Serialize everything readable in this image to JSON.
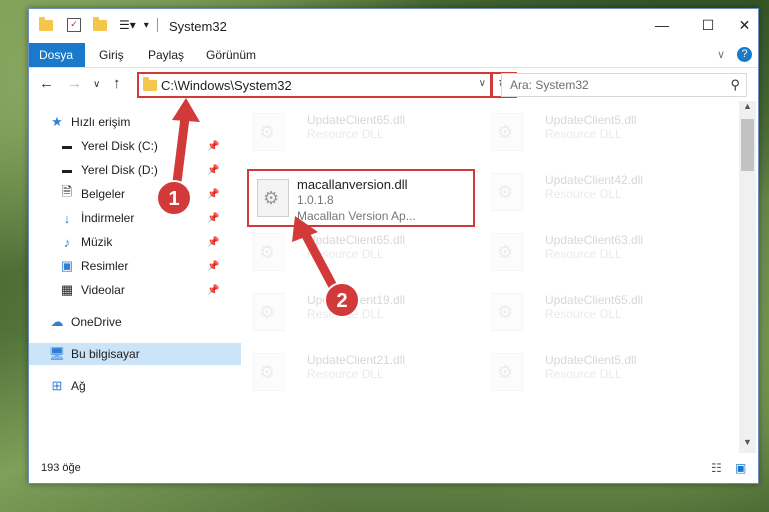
{
  "window": {
    "title": "System32",
    "ribbon_tabs": [
      "Dosya",
      "Giriş",
      "Paylaş",
      "Görünüm"
    ]
  },
  "address_bar": {
    "path": "C:\\Windows\\System32",
    "search_placeholder": "Ara: System32"
  },
  "sidebar": {
    "items": [
      {
        "label": "Hızlı erişim",
        "icon": "star-icon"
      },
      {
        "label": "Yerel Disk (C:)",
        "icon": "drive-icon"
      },
      {
        "label": "Yerel Disk (D:)",
        "icon": "drive-icon"
      },
      {
        "label": "Belgeler",
        "icon": "documents-icon"
      },
      {
        "label": "İndirmeler",
        "icon": "download-icon"
      },
      {
        "label": "Müzik",
        "icon": "music-icon"
      },
      {
        "label": "Resimler",
        "icon": "pictures-icon"
      },
      {
        "label": "Videolar",
        "icon": "videos-icon"
      },
      {
        "label": "OneDrive",
        "icon": "cloud-icon"
      },
      {
        "label": "Bu bilgisayar",
        "icon": "computer-icon"
      },
      {
        "label": "Ağ",
        "icon": "network-icon"
      }
    ]
  },
  "files": [
    {
      "name": "UpdateClient65.dll",
      "desc": "Resource DLL"
    },
    {
      "name": "UpdateClient5.dll",
      "desc": "Resource DLL"
    },
    {
      "name": "macallanversion.dll",
      "version": "1.0.1.8",
      "desc": "Macallan Version Ap..."
    },
    {
      "name": "UpdateClient42.dll",
      "desc": "Resource DLL"
    },
    {
      "name": "UpdateClient65.dll",
      "desc": "Resource DLL"
    },
    {
      "name": "UpdateClient63.dll",
      "desc": "Resource DLL"
    },
    {
      "name": "UpdateClient19.dll",
      "desc": "Resource DLL"
    },
    {
      "name": "UpdateClient65.dll",
      "desc": "Resource DLL"
    },
    {
      "name": "UpdateClient21.dll",
      "desc": "Resource DLL"
    },
    {
      "name": "UpdateClient5.dll",
      "desc": "Resource DLL"
    }
  ],
  "status": {
    "item_count": "193 öğe"
  },
  "annotations": {
    "step1": "1",
    "step2": "2"
  },
  "colors": {
    "accent": "#1979ca",
    "highlight": "#d23a3a",
    "selected_bg": "#cce4f7"
  }
}
